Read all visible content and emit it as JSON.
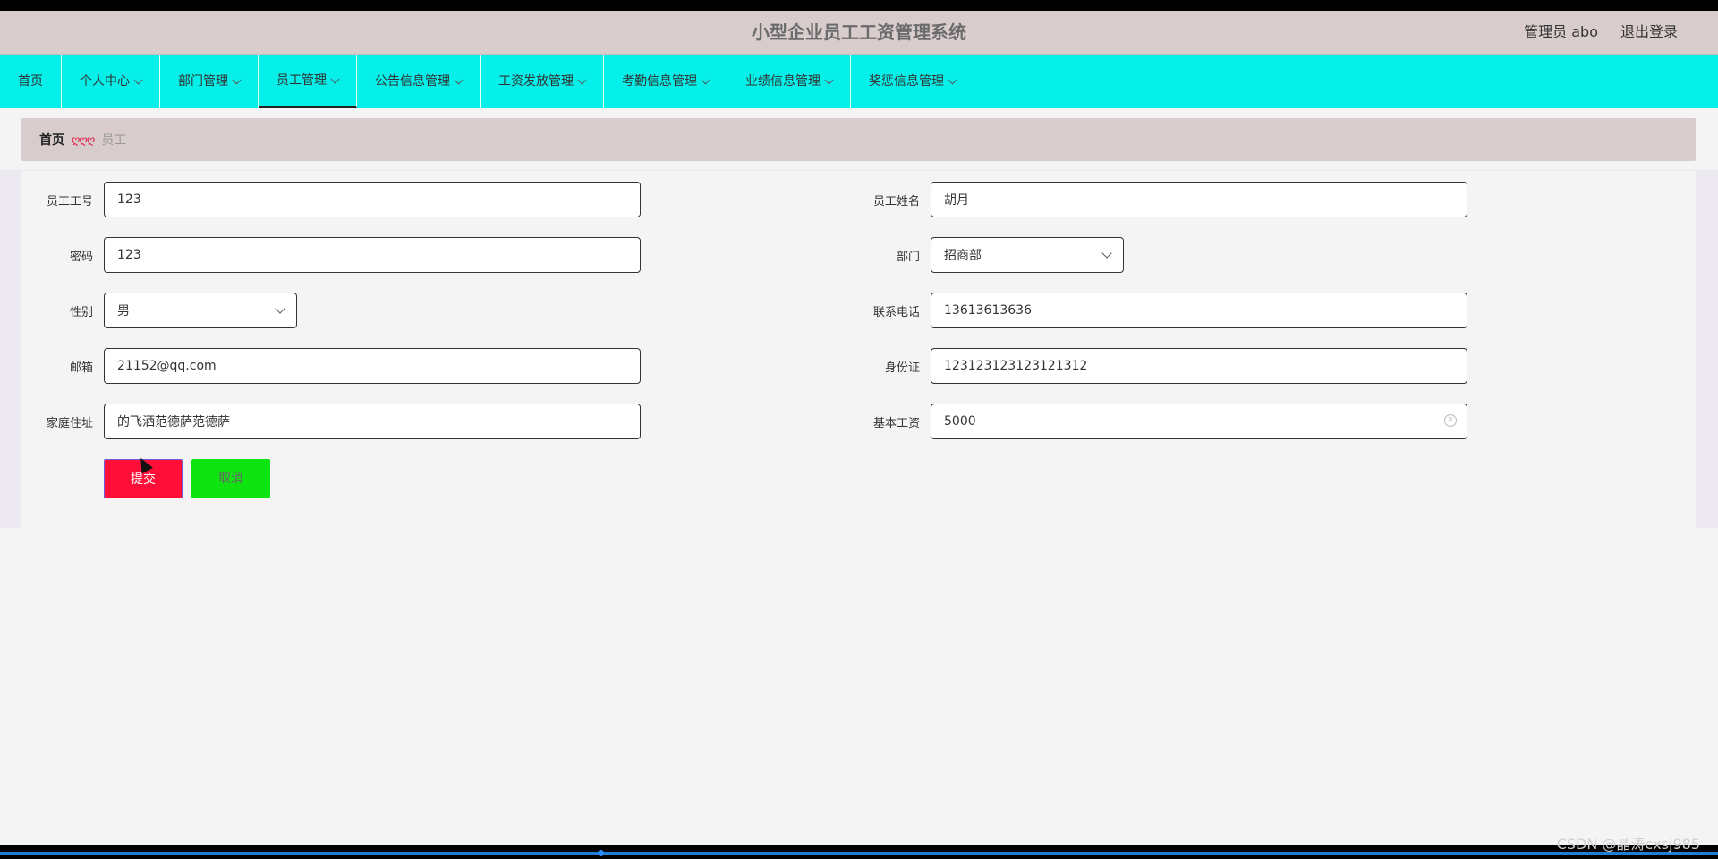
{
  "header": {
    "title": "小型企业员工工资管理系统",
    "user": "管理员 abo",
    "logout": "退出登录"
  },
  "nav": {
    "items": [
      {
        "label": "首页",
        "has_dropdown": false
      },
      {
        "label": "个人中心",
        "has_dropdown": true
      },
      {
        "label": "部门管理",
        "has_dropdown": true
      },
      {
        "label": "员工管理",
        "has_dropdown": true,
        "active": true
      },
      {
        "label": "公告信息管理",
        "has_dropdown": true
      },
      {
        "label": "工资发放管理",
        "has_dropdown": true
      },
      {
        "label": "考勤信息管理",
        "has_dropdown": true
      },
      {
        "label": "业绩信息管理",
        "has_dropdown": true
      },
      {
        "label": "奖惩信息管理",
        "has_dropdown": true
      }
    ]
  },
  "breadcrumb": {
    "home": "首页",
    "separator": "ღღღ",
    "current": "员工"
  },
  "form": {
    "employee_no": {
      "label": "员工工号",
      "value": "123"
    },
    "employee_name": {
      "label": "员工姓名",
      "value": "胡月"
    },
    "password": {
      "label": "密码",
      "value": "123"
    },
    "department": {
      "label": "部门",
      "value": "招商部"
    },
    "gender": {
      "label": "性别",
      "value": "男"
    },
    "phone": {
      "label": "联系电话",
      "value": "13613613636"
    },
    "email": {
      "label": "邮箱",
      "value": "21152@qq.com"
    },
    "id_card": {
      "label": "身份证",
      "value": "123123123123121312"
    },
    "address": {
      "label": "家庭住址",
      "value": "的飞洒范德萨范德萨"
    },
    "salary": {
      "label": "基本工资",
      "value": "5000"
    },
    "submit": "提交",
    "cancel": "取消"
  },
  "watermark": "CSDN @晶涛cxsj985",
  "colors": {
    "nav_bg": "#05f0e8",
    "header_bg": "#d8cccd",
    "submit_bg": "#ff0f38",
    "cancel_bg": "#0ee410"
  }
}
